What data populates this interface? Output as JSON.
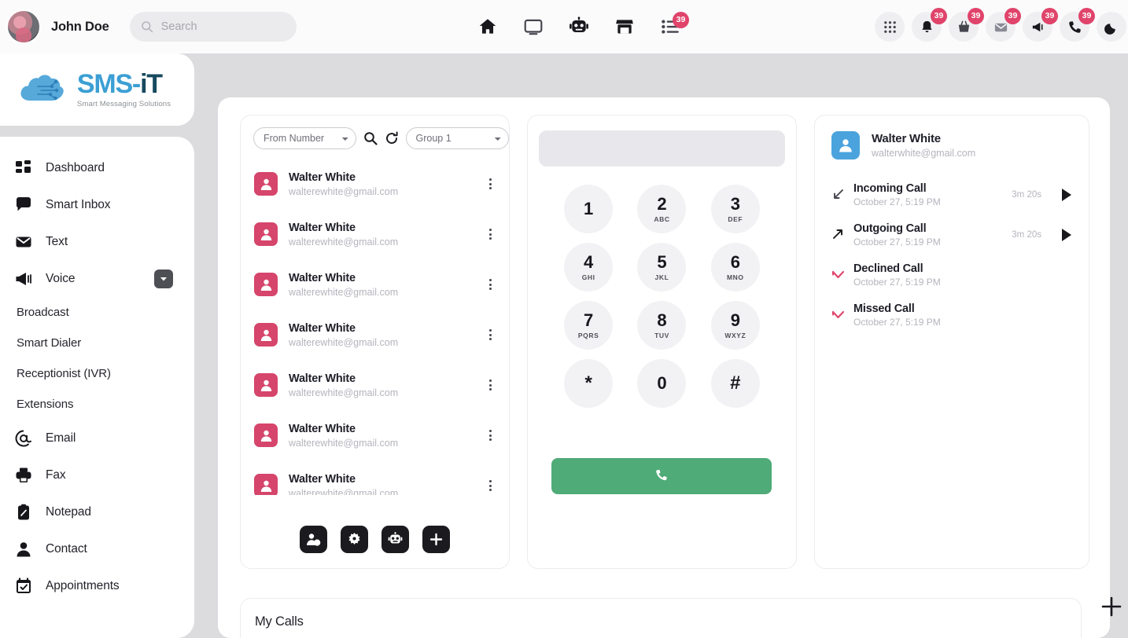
{
  "topbar": {
    "user_name": "John Doe",
    "user_caret_icon": "chevron-down-icon",
    "avatar_icon": "avatar",
    "search": {
      "placeholder": "Search",
      "value": "",
      "icon": "search-icon"
    },
    "center_nav": [
      {
        "name": "home-icon",
        "badge": ""
      },
      {
        "name": "monitor-icon",
        "badge": ""
      },
      {
        "name": "robot-icon",
        "badge": ""
      },
      {
        "name": "store-icon",
        "badge": ""
      },
      {
        "name": "tasklist-icon",
        "badge": "39"
      }
    ],
    "right_nav": [
      {
        "name": "apps-grid-icon",
        "badge": ""
      },
      {
        "name": "bell-icon",
        "badge": "39"
      },
      {
        "name": "basket-icon",
        "badge": "39"
      },
      {
        "name": "mail-icon",
        "badge": "39"
      },
      {
        "name": "megaphone-icon",
        "badge": "39"
      },
      {
        "name": "phone-icon",
        "badge": "39"
      },
      {
        "name": "moon-icon",
        "badge": ""
      }
    ]
  },
  "sidebar": {
    "logo": {
      "title_light": "SMS-",
      "title_dark": "iT",
      "subtitle": "Smart Messaging Solutions"
    },
    "items": [
      {
        "label": "Dashboard",
        "icon": "grid-icon",
        "type": "main"
      },
      {
        "label": "Smart Inbox",
        "icon": "chat-bubble-icon",
        "type": "main"
      },
      {
        "label": "Text",
        "icon": "envelope-icon",
        "type": "main"
      },
      {
        "label": "Voice",
        "icon": "megaphone-icon",
        "type": "main",
        "toggle": "chevron-down-icon",
        "expanded": true
      },
      {
        "label": "Broadcast",
        "icon": "",
        "type": "sub"
      },
      {
        "label": "Smart Dialer",
        "icon": "",
        "type": "sub"
      },
      {
        "label": "Receptionist (IVR)",
        "icon": "",
        "type": "sub"
      },
      {
        "label": "Extensions",
        "icon": "",
        "type": "sub"
      },
      {
        "label": "Email",
        "icon": "at-icon",
        "type": "main"
      },
      {
        "label": "Fax",
        "icon": "printer-icon",
        "type": "main"
      },
      {
        "label": "Notepad",
        "icon": "clipboard-icon",
        "type": "main"
      },
      {
        "label": "Contact",
        "icon": "person-icon",
        "type": "main"
      },
      {
        "label": "Appointments",
        "icon": "calendar-check-icon",
        "type": "main"
      }
    ]
  },
  "contacts": {
    "from_number_select": {
      "value": "From Number",
      "options": [
        "From Number"
      ]
    },
    "group_select": {
      "value": "Group 1",
      "options": [
        "Group 1"
      ]
    },
    "search_icon": "search-icon",
    "refresh_icon": "refresh-icon",
    "rows": [
      {
        "name": "Walter White",
        "email": "walterewhite@gmail.com"
      },
      {
        "name": "Walter White",
        "email": "walterewhite@gmail.com"
      },
      {
        "name": "Walter White",
        "email": "walterewhite@gmail.com"
      },
      {
        "name": "Walter White",
        "email": "walterewhite@gmail.com"
      },
      {
        "name": "Walter White",
        "email": "walterewhite@gmail.com"
      },
      {
        "name": "Walter White",
        "email": "walterewhite@gmail.com"
      },
      {
        "name": "Walter White",
        "email": "walterewhite@gmail.com"
      }
    ],
    "actions": [
      {
        "name": "add-contact-icon"
      },
      {
        "name": "gear-icon"
      },
      {
        "name": "robot-icon"
      },
      {
        "name": "plus-icon"
      }
    ],
    "avatar_color": "#d6456b"
  },
  "dialpad": {
    "display_value": "",
    "keys": [
      {
        "num": "1",
        "sub": ""
      },
      {
        "num": "2",
        "sub": "ABC"
      },
      {
        "num": "3",
        "sub": "DEF"
      },
      {
        "num": "4",
        "sub": "GHI"
      },
      {
        "num": "5",
        "sub": "JKL"
      },
      {
        "num": "6",
        "sub": "MNO"
      },
      {
        "num": "7",
        "sub": "PQRS"
      },
      {
        "num": "8",
        "sub": "TUV"
      },
      {
        "num": "9",
        "sub": "WXYZ"
      },
      {
        "num": "*",
        "sub": ""
      },
      {
        "num": "0",
        "sub": ""
      },
      {
        "num": "#",
        "sub": ""
      }
    ],
    "call_button": {
      "icon": "phone-icon",
      "color": "#4fab77"
    }
  },
  "history": {
    "contact": {
      "name": "Walter White",
      "email": "walterwhite@gmail.com",
      "avatar_color": "#4aa3dd"
    },
    "entries": [
      {
        "title": "Incoming Call",
        "date": "October 27, 5:19 PM",
        "duration": "3m 20s",
        "icon": "arrow-down-left-icon",
        "has_play": true
      },
      {
        "title": "Outgoing Call",
        "date": "October 27, 5:19 PM",
        "duration": "3m 20s",
        "icon": "arrow-up-right-icon",
        "has_play": true
      },
      {
        "title": "Declined Call",
        "date": "October 27, 5:19 PM",
        "duration": "",
        "icon": "declined-call-icon",
        "has_play": false
      },
      {
        "title": "Missed Call",
        "date": "October 27, 5:19 PM",
        "duration": "",
        "icon": "missed-call-icon",
        "has_play": false
      }
    ]
  },
  "bottom": {
    "my_calls_title": "My Calls",
    "fab_icon": "plus-icon"
  }
}
